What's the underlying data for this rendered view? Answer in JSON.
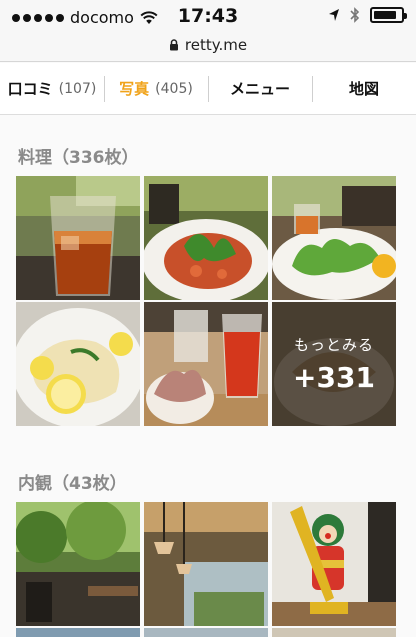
{
  "status_bar": {
    "carrier": "docomo",
    "time": "17:43",
    "battery_level": 0.85
  },
  "browser": {
    "url": "retty.me"
  },
  "tabs": [
    {
      "label": "口コミ",
      "count": "(107)",
      "active": false
    },
    {
      "label": "写真",
      "count": "(405)",
      "active": true
    },
    {
      "label": "メニュー",
      "count": "",
      "active": false
    },
    {
      "label": "地図",
      "count": "",
      "active": false
    }
  ],
  "sections": {
    "food": {
      "title": "料理（336枚）",
      "photos": [
        "iced-tea",
        "tomato-salad-pasta",
        "green-salad",
        "lemon-pasta",
        "dessert-and-drinks"
      ],
      "more": {
        "label": "もっとみる",
        "count": "+331"
      }
    },
    "interior": {
      "title": "内観（43枚）",
      "photos": [
        "garden-terrace",
        "dining-room-lamps",
        "clown-statue"
      ]
    }
  },
  "colors": {
    "accent": "#f0a31a",
    "section_title": "#8a8a8a"
  },
  "icons": [
    "wifi-icon",
    "lock-icon",
    "location-arrow-icon",
    "bluetooth-icon",
    "battery-icon"
  ]
}
